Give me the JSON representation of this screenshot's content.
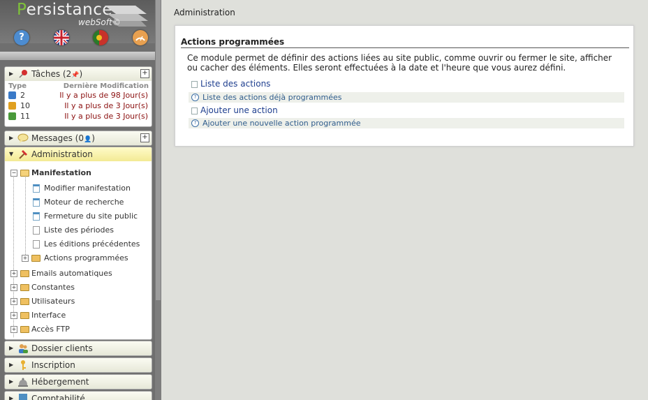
{
  "logo": {
    "name_first": "P",
    "name_rest": "ersistance",
    "sub": "webSoft©"
  },
  "quick_icons": [
    {
      "name": "help-icon",
      "glyph": "?",
      "color": "#4d8cd0"
    },
    {
      "name": "english-flag-icon",
      "glyph": "",
      "color": "#c0c8e0"
    },
    {
      "name": "portugal-flag-icon",
      "glyph": "",
      "color": "#c8322a"
    },
    {
      "name": "dashboard-icon",
      "glyph": "",
      "color": "#e8a050"
    }
  ],
  "sidebar": {
    "taches": {
      "title": "Tâches (2",
      "count_suffix": ")",
      "col_type": "Type",
      "col_modif": "Dernière Modification",
      "rows": [
        {
          "num": "2",
          "value": "Il y a plus de 98 Jour(s)",
          "color": "#3a7ac8"
        },
        {
          "num": "10",
          "value": "Il y a plus de 3 Jour(s)",
          "color": "#e0a020"
        },
        {
          "num": "11",
          "value": "Il y a plus de 3 Jour(s)",
          "color": "#4a9a3a"
        }
      ]
    },
    "messages": {
      "title": "Messages (0",
      "suffix": ")"
    },
    "administration": {
      "title": "Administration",
      "tree": {
        "manifestation": "Manifestation",
        "children": [
          "Modifier manifestation",
          "Moteur de recherche",
          "Fermeture du site public",
          "Liste des périodes",
          "Les éditions précédentes",
          "Actions programmées"
        ],
        "others": [
          "Emails automatiques",
          "Constantes",
          "Utilisateurs",
          "Interface",
          "Accès FTP"
        ]
      }
    },
    "dossier_clients": "Dossier clients",
    "inscription": "Inscription",
    "hebergement": "Hébergement",
    "comptabilite": "Comptabilité"
  },
  "main": {
    "breadcrumb": "Administration",
    "card_title": "Actions programmées",
    "description": "Ce module permet de définir des actions liées au site public, comme ouvrir ou fermer le site, afficher ou cacher des éléments. Elles seront effectuées à la date et l'heure que vous aurez défini.",
    "links": [
      {
        "label": "Liste des actions",
        "kind": "list"
      },
      {
        "label": "Liste des actions déjà programmées",
        "kind": "help"
      },
      {
        "label": "Ajouter une action",
        "kind": "page"
      },
      {
        "label": "Ajouter une nouvelle action programmée",
        "kind": "help"
      }
    ]
  }
}
